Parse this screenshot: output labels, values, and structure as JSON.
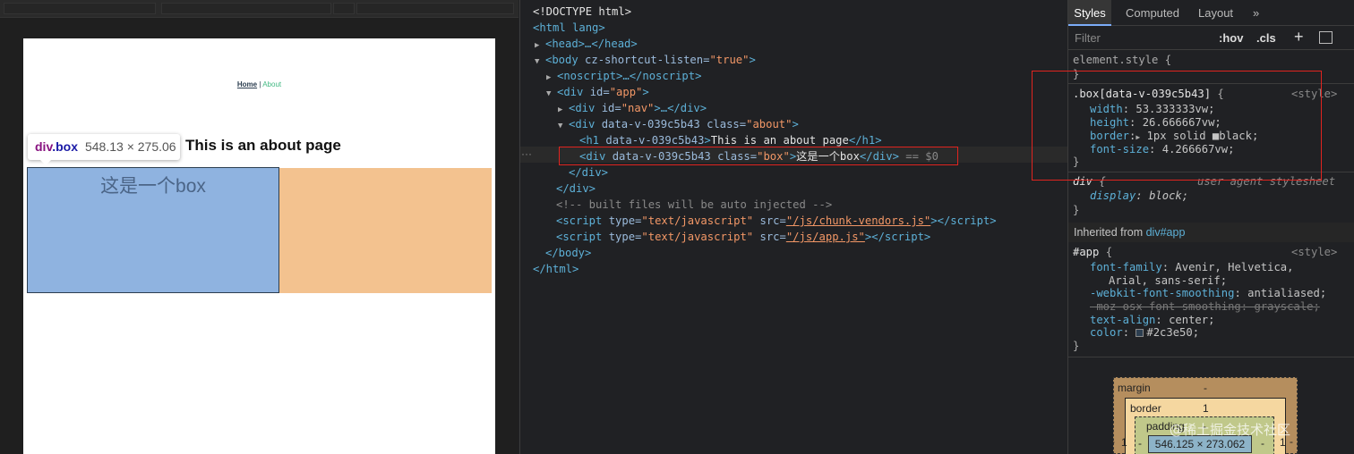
{
  "page": {
    "nav_home": "Home",
    "nav_sep": " | ",
    "nav_about": "About",
    "title": "This is an about page",
    "box_text": "这是一个box"
  },
  "tooltip": {
    "tag": "div",
    "cls": ".box",
    "dims": "548.13 × 275.06"
  },
  "elements": {
    "doctype": "<!DOCTYPE html>",
    "html_open": "<html lang>",
    "head": "<head>…</head>",
    "body_open_tag": "<body ",
    "body_attr": "cz-shortcut-listen",
    "body_val": "\"true\"",
    "noscript": "<noscript>…</noscript>",
    "div_app_tag": "<div ",
    "div_app_attr": "id=",
    "div_app_val": "\"app\"",
    "div_nav_attr": "id=",
    "div_nav_val": "\"nav\"",
    "div_nav_rest": ">…</div>",
    "div_about_attr": "data-v-039c5b43 class=",
    "div_about_val": "\"about\"",
    "h1_attr": "data-v-039c5b43",
    "h1_text": "This is an about page",
    "div_box_attr": "data-v-039c5b43 class=",
    "div_box_val": "\"box\"",
    "div_box_text": "这是一个box",
    "div_box_marker": " == $0",
    "comment": "<!-- built files will be auto injected -->",
    "script1_src": "\"/js/chunk-vendors.js\"",
    "script2_src": "\"/js/app.js\"",
    "script_type": "\"text/javascript\"",
    "body_close": "</body>",
    "html_close": "</html>",
    "div_close": "</div>"
  },
  "styles": {
    "tabs": [
      "Styles",
      "Computed",
      "Layout",
      "»"
    ],
    "filter_placeholder": "Filter",
    "hov": ":hov",
    "cls": ".cls",
    "plus": "+",
    "element_style": "element.style {",
    "box_selector": ".box[data-v-039c5b43]",
    "box_source": "<style>",
    "box_rules": [
      {
        "prop": "width",
        "val": "53.333333vw;"
      },
      {
        "prop": "height",
        "val": "26.666667vw;"
      },
      {
        "prop": "border",
        "val": "1px solid ■black;"
      },
      {
        "prop": "font-size",
        "val": "4.266667vw;"
      }
    ],
    "div_selector": "div",
    "div_source": "user agent stylesheet",
    "div_rule_prop": "display",
    "div_rule_val": "block;",
    "inherited_label": "Inherited from",
    "inherited_from": "div#app",
    "app_selector": "#app",
    "app_source": "<style>",
    "app_rules": [
      {
        "prop": "font-family",
        "val": "Avenir, Helvetica,"
      },
      {
        "prop": "",
        "val": "Arial, sans-serif;"
      },
      {
        "prop": "-webkit-font-smoothing",
        "val": "antialiased;"
      },
      {
        "prop": "-moz-osx-font-smoothing",
        "val": "grayscale;"
      },
      {
        "prop": "text-align",
        "val": "center;"
      },
      {
        "prop": "color",
        "val": "#2c3e50;"
      }
    ],
    "boxmodel": {
      "margin_label": "margin",
      "margin_value": "-",
      "border_label": "border",
      "border_value": "1",
      "padding_label": "padding",
      "padding_value": "-",
      "content": "546.125 × 273.062",
      "left_margin": "-",
      "left_border": "1",
      "left_padding": "-",
      "right_padding": "-",
      "right_border": "1",
      "right_margin": "-"
    }
  },
  "watermark": "@稀土掘金技术社区",
  "colors": {
    "app_color": "#2c3e50",
    "accent": "#42b983",
    "highlight": "#e0241f"
  }
}
